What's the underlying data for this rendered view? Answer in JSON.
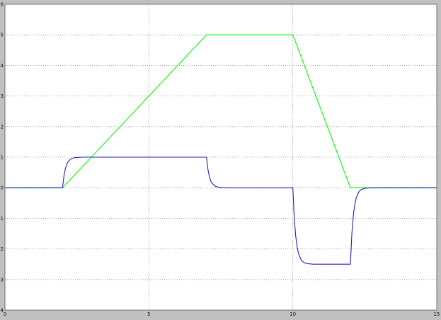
{
  "chart_data": {
    "type": "line",
    "title": "",
    "xlabel": "",
    "ylabel": "",
    "xlim": [
      0,
      15
    ],
    "ylim": [
      -4,
      6
    ],
    "grid": true,
    "legend": "none",
    "background": "#ffffff",
    "frame_color": "#c0c0c0",
    "grid_color": "#8c8c8c",
    "xticks": [
      0,
      5,
      10,
      15
    ],
    "xtick_labels": [
      "0",
      "5",
      "10",
      "15"
    ],
    "yticks": [
      -4,
      -3,
      -2,
      -1,
      0,
      1,
      2,
      3,
      4,
      5,
      6
    ],
    "ytick_labels": [
      "-4",
      "-3",
      "-2",
      "-1",
      "0",
      "1",
      "2",
      "3",
      "4",
      "5",
      "6"
    ],
    "series": [
      {
        "color": "#00ff00",
        "x": [
          0,
          2,
          7,
          10,
          12,
          15
        ],
        "y": [
          0,
          0,
          5,
          5,
          0,
          0
        ]
      },
      {
        "color": "#2020c0",
        "x": [
          0,
          2,
          2.05,
          2.1,
          2.15,
          2.2,
          2.3,
          2.4,
          2.5,
          2.7,
          3,
          7,
          7.05,
          7.1,
          7.15,
          7.2,
          7.3,
          7.4,
          7.5,
          7.7,
          8,
          10,
          10.05,
          10.1,
          10.15,
          10.2,
          10.3,
          10.4,
          10.5,
          10.7,
          11,
          12,
          12.05,
          12.1,
          12.15,
          12.2,
          12.3,
          12.4,
          12.5,
          12.7,
          13,
          15
        ],
        "y": [
          0,
          0,
          0.39,
          0.63,
          0.78,
          0.86,
          0.95,
          0.98,
          0.99,
          1,
          1,
          1,
          0.61,
          0.37,
          0.22,
          0.14,
          0.05,
          0.02,
          0.01,
          0,
          0,
          0,
          -0.98,
          -1.58,
          -1.94,
          -2.16,
          -2.38,
          -2.45,
          -2.48,
          -2.5,
          -2.5,
          -2.5,
          -1.52,
          -0.92,
          -0.56,
          -0.34,
          -0.12,
          -0.05,
          -0.02,
          0,
          0,
          0
        ]
      }
    ]
  }
}
